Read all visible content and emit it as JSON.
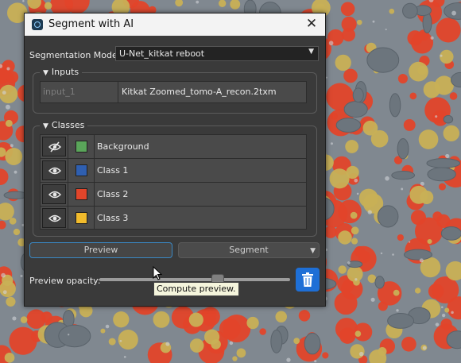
{
  "window": {
    "title": "Segment with AI",
    "close_glyph": "✕"
  },
  "model": {
    "label": "Segmentation Model:",
    "selected": "U-Net_kitkat reboot"
  },
  "inputs": {
    "header": "Inputs",
    "rows": [
      {
        "name": "input_1",
        "value": "Kitkat Zoomed_tomo-A_recon.2txm"
      }
    ]
  },
  "classes": {
    "header": "Classes",
    "rows": [
      {
        "label": "Background",
        "color": "#5aa55a",
        "visible": false
      },
      {
        "label": "Class 1",
        "color": "#2f5fb0",
        "visible": true
      },
      {
        "label": "Class 2",
        "color": "#e2452a",
        "visible": true
      },
      {
        "label": "Class 3",
        "color": "#f1bb2c",
        "visible": true
      }
    ]
  },
  "actions": {
    "preview_label": "Preview",
    "segment_label": "Segment"
  },
  "opacity": {
    "label": "Preview opacity:",
    "value": 0.62
  },
  "tooltip": {
    "text": "Compute preview."
  },
  "colors": {
    "background_image": "#6c757d",
    "overlay_class2": "#e2452a",
    "overlay_class3": "#c8b056",
    "accent": "#1e6fd6"
  }
}
